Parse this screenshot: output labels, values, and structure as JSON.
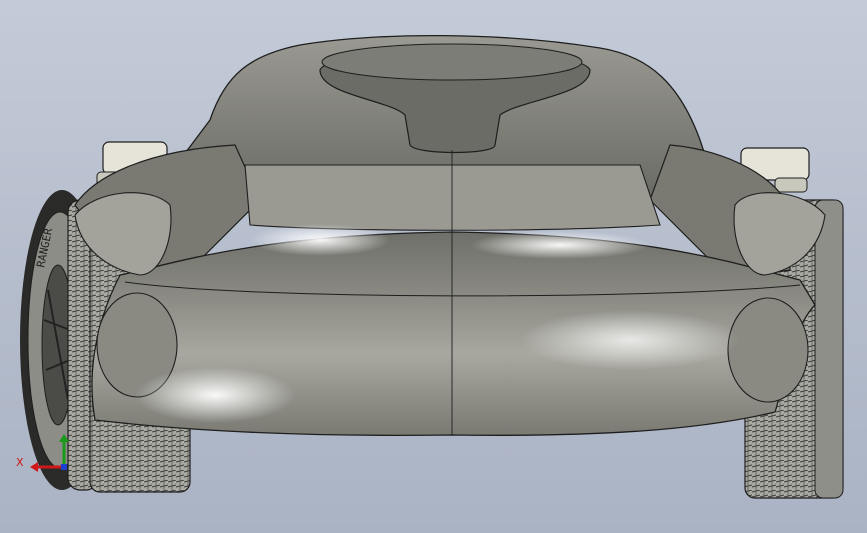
{
  "viewport": {
    "background_top": "#c4cbd8",
    "background_bottom": "#aab3c4"
  },
  "model": {
    "icon": "car-model-front-view",
    "body_color": "#8c8c84",
    "highlight_color": "#f2f2ee",
    "edge_color": "#1e1e1e",
    "tire_color": "#9a9a94",
    "mirror_color": "#e4e2d6",
    "tire_sidewall_text": "RANGER"
  },
  "triad": {
    "icon": "coordinate-triad-icon",
    "x_label": "X",
    "y_label": "",
    "x_color": "#d01818",
    "y_color": "#1a9a1a",
    "z_color": "#1f3fd0"
  }
}
